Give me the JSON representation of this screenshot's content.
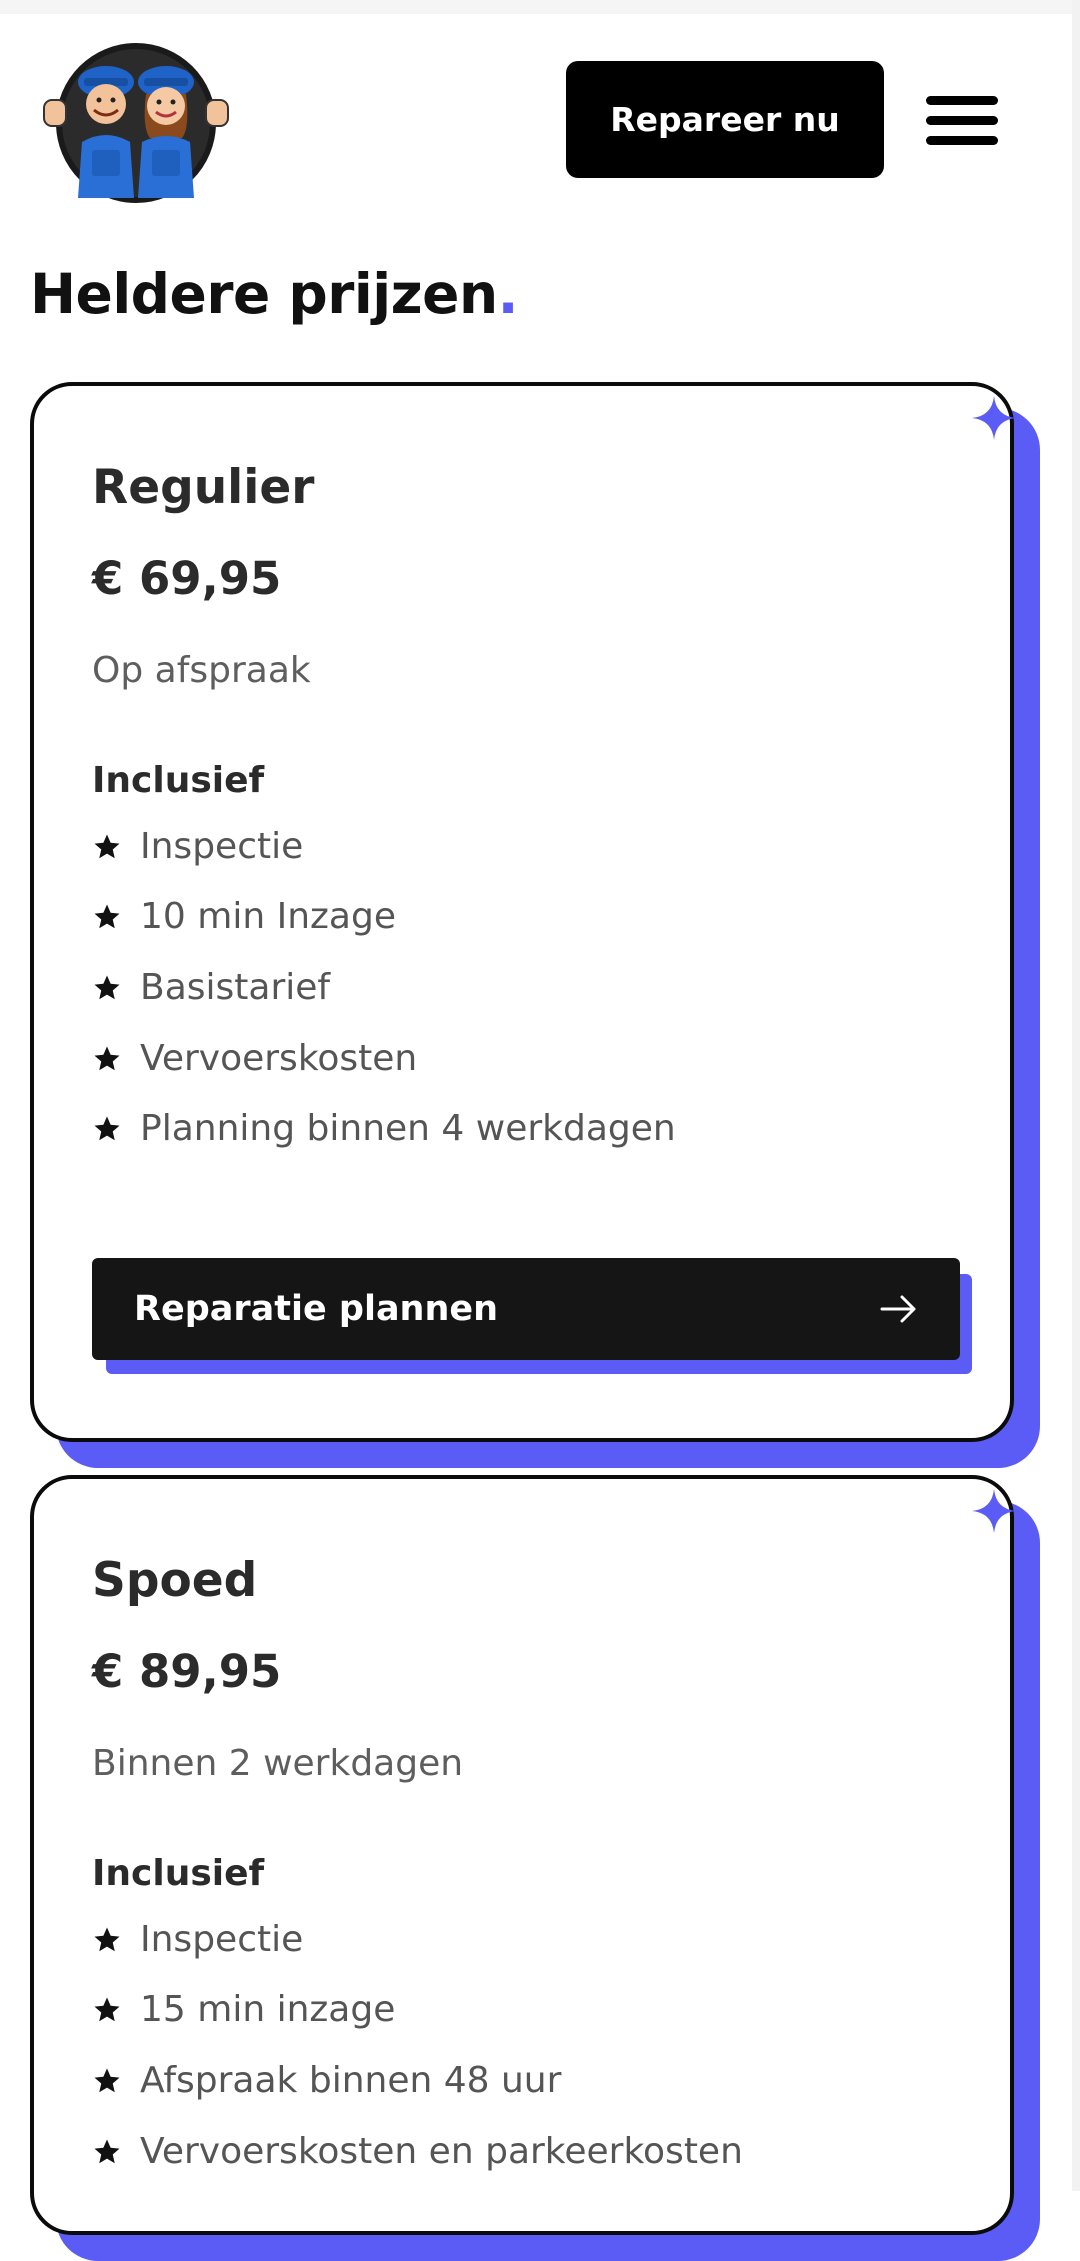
{
  "header": {
    "logo_alt": "Two smiling mechanics in blue caps and overalls giving thumbs up",
    "cta_label": "Repareer nu",
    "menu_icon": "hamburger-menu-icon"
  },
  "section": {
    "title": "Heldere prijzen",
    "title_dot": "."
  },
  "colors": {
    "accent": "#5b5cf6",
    "text": "#111111",
    "muted": "#5e5e5e",
    "button_dark": "#151515"
  },
  "plans": [
    {
      "name": "Regulier",
      "price": "€ 69,95",
      "subtitle": "Op afspraak",
      "includes_label": "Inclusief",
      "features": [
        "Inspectie",
        "10 min Inzage",
        "Basistarief",
        "Vervoerskosten",
        "Planning binnen 4 werkdagen"
      ],
      "button_label": "Reparatie plannen",
      "button_icon": "arrow-right-icon"
    },
    {
      "name": "Spoed",
      "price": "€ 89,95",
      "subtitle": "Binnen 2 werkdagen",
      "includes_label": "Inclusief",
      "features": [
        "Inspectie",
        "15 min inzage",
        "Afspraak binnen 48 uur",
        "Vervoerskosten en parkeerkosten"
      ]
    }
  ]
}
